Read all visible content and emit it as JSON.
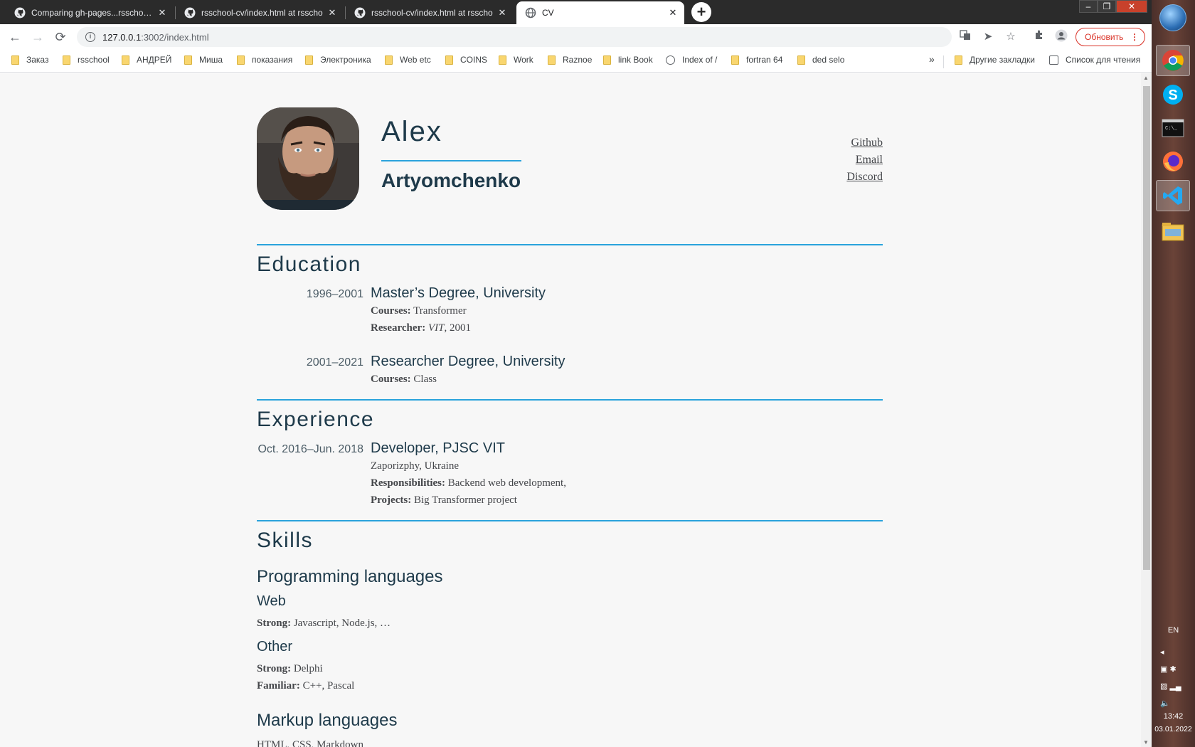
{
  "browser": {
    "tabs": [
      {
        "title": "Comparing gh-pages...rsschool-c",
        "icon": "github-icon",
        "active": false
      },
      {
        "title": "rsschool-cv/index.html at rsscho",
        "icon": "github-icon",
        "active": false
      },
      {
        "title": "rsschool-cv/index.html at rsscho",
        "icon": "github-icon",
        "active": false
      },
      {
        "title": "CV",
        "icon": "globe-icon",
        "active": true
      }
    ],
    "url_host": "127.0.0.1",
    "url_rest": ":3002/index.html",
    "update_button": "Обновить",
    "bookmarks": [
      {
        "label": "Заказ",
        "icon": "folder"
      },
      {
        "label": "rsschool",
        "icon": "folder"
      },
      {
        "label": "АНДРЕЙ",
        "icon": "folder"
      },
      {
        "label": "Миша",
        "icon": "folder"
      },
      {
        "label": "показания",
        "icon": "folder"
      },
      {
        "label": "Электроника",
        "icon": "folder"
      },
      {
        "label": "Web etc",
        "icon": "folder"
      },
      {
        "label": "COINS",
        "icon": "folder"
      },
      {
        "label": "Work",
        "icon": "folder"
      },
      {
        "label": "Raznoe",
        "icon": "folder"
      },
      {
        "label": "link Book",
        "icon": "folder"
      },
      {
        "label": "Index of /",
        "icon": "globe"
      },
      {
        "label": "fortran 64",
        "icon": "folder"
      },
      {
        "label": "ded selo",
        "icon": "folder"
      }
    ],
    "bookmarks_overflow": "»",
    "other_bookmarks": "Другие закладки",
    "reading_list": "Список для чтения"
  },
  "cv": {
    "first_name": "Alex",
    "last_name": "Artyomchenko",
    "links": [
      "Github",
      "Email",
      "Discord"
    ],
    "education": {
      "title": "Education",
      "entries": [
        {
          "date": "1996–2001",
          "degree": "Master’s Degree",
          "school": "University",
          "courses_label": "Courses:",
          "courses": "Transformer",
          "researcher_label": "Researcher:",
          "researcher_org": "VIT",
          "researcher_year": ", 2001"
        },
        {
          "date": "2001–2021",
          "degree": "Researcher Degree",
          "school": "University",
          "courses_label": "Courses:",
          "courses": "Class"
        }
      ]
    },
    "experience": {
      "title": "Experience",
      "entries": [
        {
          "date": "Oct. 2016–Jun. 2018",
          "role": "Developer",
          "company": "PJSC VIT",
          "location": "Zaporizphy, Ukraine",
          "resp_label": "Responsibilities:",
          "resp": "Backend web development,",
          "proj_label": "Projects:",
          "proj": "Big Transformer project"
        }
      ]
    },
    "skills": {
      "title": "Skills",
      "programming_title": "Programming languages",
      "web_title": "Web",
      "web_strong_label": "Strong:",
      "web_strong": "Javascript, Node.js, …",
      "other_title": "Other",
      "other_strong_label": "Strong:",
      "other_strong": "Delphi",
      "other_familiar_label": "Familiar:",
      "other_familiar": "C++, Pascal",
      "markup_title": "Markup languages",
      "markup_list": "HTML, CSS, Markdown"
    }
  },
  "taskbar": {
    "apps": [
      "chrome-icon",
      "skype-icon",
      "cmd-icon",
      "firefox-icon",
      "vscode-icon",
      "explorer-icon"
    ],
    "lang": "EN",
    "time": "13:42",
    "date": "03.01.2022"
  },
  "colors": {
    "accent": "#2aa3dc",
    "heading": "#1e3a4a",
    "update": "#d93025"
  }
}
